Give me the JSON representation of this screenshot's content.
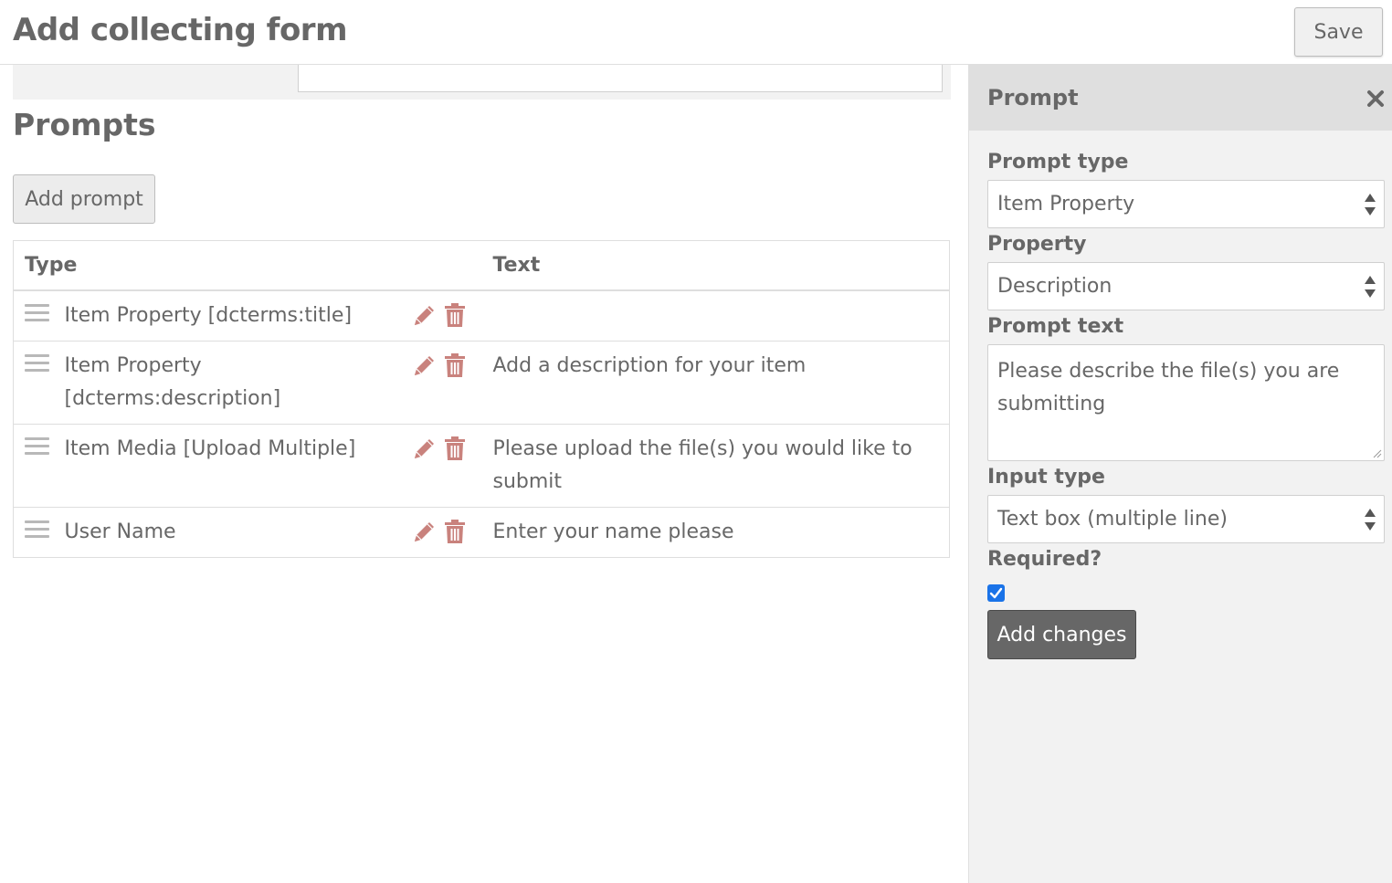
{
  "header": {
    "title": "Add collecting form",
    "save_label": "Save"
  },
  "prompts_section": {
    "title": "Prompts",
    "add_prompt_label": "Add prompt",
    "columns": {
      "type": "Type",
      "text": "Text"
    },
    "rows": [
      {
        "type": "Item Property [dcterms:title]",
        "text": ""
      },
      {
        "type": "Item Property [dcterms:description]",
        "text": "Add a description for your item"
      },
      {
        "type": "Item Media [Upload Multiple]",
        "text": "Please upload the file(s) you would like to submit"
      },
      {
        "type": "User Name",
        "text": "Enter your name please"
      }
    ]
  },
  "sidebar": {
    "title": "Prompt",
    "prompt_type_label": "Prompt type",
    "prompt_type_value": "Item Property",
    "property_label": "Property",
    "property_value": "Description",
    "prompt_text_label": "Prompt text",
    "prompt_text_value": "Please describe the file(s) you are submitting",
    "input_type_label": "Input type",
    "input_type_value": "Text box (multiple line)",
    "required_label": "Required?",
    "required_checked": true,
    "add_changes_label": "Add changes"
  },
  "colors": {
    "action_icon": "#c9827d",
    "accent_checkbox": "#1a73e8",
    "primary_button": "#676767"
  },
  "icons": {
    "row_handle": "drag-handle-icon",
    "edit": "pencil-icon",
    "delete": "trash-icon",
    "close": "close-icon"
  }
}
